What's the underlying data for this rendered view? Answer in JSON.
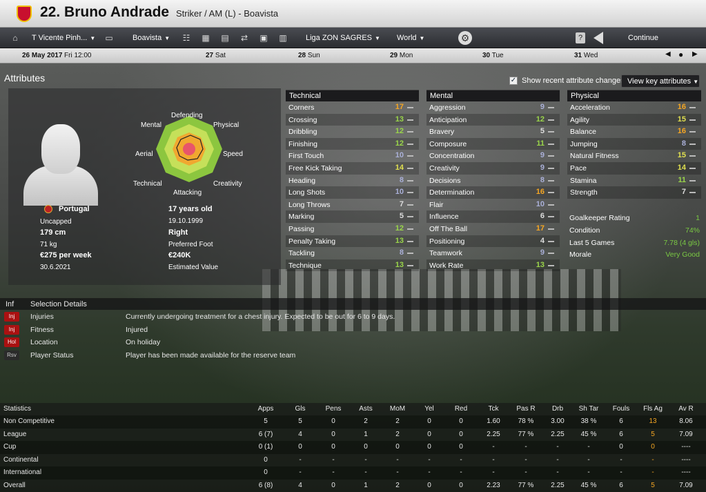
{
  "player": {
    "number_name": "22. Bruno Andrade",
    "position_club": "Striker / AM (L) - Boavista"
  },
  "nav": {
    "manager": "T Vicente Pinh...",
    "club": "Boavista",
    "league": "Liga ZON SAGRES",
    "world": "World",
    "continue": "Continue"
  },
  "datebar": {
    "date": "26 May 2017",
    "day_time": "Fri 12:00",
    "days": [
      {
        "n": "27",
        "d": "Sat"
      },
      {
        "n": "28",
        "d": "Sun"
      },
      {
        "n": "29",
        "d": "Mon"
      },
      {
        "n": "30",
        "d": "Tue"
      },
      {
        "n": "31",
        "d": "Wed"
      }
    ]
  },
  "attributes": {
    "title": "Attributes",
    "show_recent": "Show recent attribute changes",
    "view_key": "View key attributes"
  },
  "radar": {
    "defending": "Defending",
    "physical": "Physical",
    "speed": "Speed",
    "creativity": "Creativity",
    "attacking": "Attacking",
    "technical": "Technical",
    "aerial": "Aerial",
    "mental": "Mental"
  },
  "profile": {
    "nation": "Portugal",
    "caps": "Uncapped",
    "height": "179 cm",
    "weight": "71 kg",
    "wage": "€275 per week",
    "contract": "30.6.2021",
    "age": "17 years old",
    "dob": "19.10.1999",
    "foot": "Right",
    "foot_label": "Preferred Foot",
    "value": "€240K",
    "value_label": "Estimated Value"
  },
  "technical": {
    "title": "Technical",
    "rows": [
      {
        "name": "Corners",
        "value": "17",
        "color": "#f5a623"
      },
      {
        "name": "Crossing",
        "value": "13",
        "color": "#9ad54a"
      },
      {
        "name": "Dribbling",
        "value": "12",
        "color": "#9ad54a"
      },
      {
        "name": "Finishing",
        "value": "12",
        "color": "#9ad54a"
      },
      {
        "name": "First Touch",
        "value": "10",
        "color": "#aab0d8"
      },
      {
        "name": "Free Kick Taking",
        "value": "14",
        "color": "#e0e050"
      },
      {
        "name": "Heading",
        "value": "8",
        "color": "#aab0d8"
      },
      {
        "name": "Long Shots",
        "value": "10",
        "color": "#aab0d8"
      },
      {
        "name": "Long Throws",
        "value": "7",
        "color": "#dddddd"
      },
      {
        "name": "Marking",
        "value": "5",
        "color": "#dddddd"
      },
      {
        "name": "Passing",
        "value": "12",
        "color": "#9ad54a"
      },
      {
        "name": "Penalty Taking",
        "value": "13",
        "color": "#9ad54a"
      },
      {
        "name": "Tackling",
        "value": "8",
        "color": "#aab0d8"
      },
      {
        "name": "Technique",
        "value": "13",
        "color": "#9ad54a"
      }
    ]
  },
  "mental": {
    "title": "Mental",
    "rows": [
      {
        "name": "Aggression",
        "value": "9",
        "color": "#aab0d8"
      },
      {
        "name": "Anticipation",
        "value": "12",
        "color": "#9ad54a"
      },
      {
        "name": "Bravery",
        "value": "5",
        "color": "#dddddd"
      },
      {
        "name": "Composure",
        "value": "11",
        "color": "#9ad54a"
      },
      {
        "name": "Concentration",
        "value": "9",
        "color": "#aab0d8"
      },
      {
        "name": "Creativity",
        "value": "9",
        "color": "#aab0d8"
      },
      {
        "name": "Decisions",
        "value": "8",
        "color": "#aab0d8"
      },
      {
        "name": "Determination",
        "value": "16",
        "color": "#f5a623"
      },
      {
        "name": "Flair",
        "value": "10",
        "color": "#aab0d8"
      },
      {
        "name": "Influence",
        "value": "6",
        "color": "#dddddd"
      },
      {
        "name": "Off The Ball",
        "value": "17",
        "color": "#f5a623"
      },
      {
        "name": "Positioning",
        "value": "4",
        "color": "#dddddd"
      },
      {
        "name": "Teamwork",
        "value": "9",
        "color": "#aab0d8"
      },
      {
        "name": "Work Rate",
        "value": "13",
        "color": "#9ad54a"
      }
    ]
  },
  "physical": {
    "title": "Physical",
    "rows": [
      {
        "name": "Acceleration",
        "value": "16",
        "color": "#f5a623"
      },
      {
        "name": "Agility",
        "value": "15",
        "color": "#e0e050"
      },
      {
        "name": "Balance",
        "value": "16",
        "color": "#f5a623"
      },
      {
        "name": "Jumping",
        "value": "8",
        "color": "#aab0d8"
      },
      {
        "name": "Natural Fitness",
        "value": "15",
        "color": "#e0e050"
      },
      {
        "name": "Pace",
        "value": "14",
        "color": "#e0e050"
      },
      {
        "name": "Stamina",
        "value": "11",
        "color": "#9ad54a"
      },
      {
        "name": "Strength",
        "value": "7",
        "color": "#dddddd"
      }
    ]
  },
  "misc": [
    {
      "name": "Goalkeeper Rating",
      "value": "1"
    },
    {
      "name": "Condition",
      "value": "74%"
    },
    {
      "name": "Last 5 Games",
      "value": "7.78 (4 gls)"
    },
    {
      "name": "Morale",
      "value": "Very Good"
    }
  ],
  "selection": {
    "inf": "Inf",
    "title": "Selection Details",
    "rows": [
      {
        "badge": "Inj",
        "name": "Injuries",
        "desc": "Currently undergoing treatment for a chest injury. Expected to be out for 6 to 9 days."
      },
      {
        "badge": "Inj",
        "name": "Fitness",
        "desc": "Injured"
      },
      {
        "badge": "Hol",
        "name": "Location",
        "desc": "On holiday"
      },
      {
        "badge": "Rsv",
        "name": "Player Status",
        "desc": "Player has been made available for the reserve team"
      }
    ]
  },
  "statistics": {
    "title": "Statistics",
    "headers": [
      "Apps",
      "Gls",
      "Pens",
      "Asts",
      "MoM",
      "Yel",
      "Red",
      "Tck",
      "Pas R",
      "Drb",
      "Sh Tar",
      "Fouls",
      "Fls Ag",
      "Av R"
    ],
    "rows": [
      {
        "label": "Non Competitive",
        "cells": [
          "5",
          "5",
          "0",
          "2",
          "2",
          "0",
          "0",
          "1.60",
          "78 %",
          "3.00",
          "38 %",
          "6",
          "13",
          "8.06"
        ]
      },
      {
        "label": "League",
        "cells": [
          "6 (7)",
          "4",
          "0",
          "1",
          "2",
          "0",
          "0",
          "2.25",
          "77 %",
          "2.25",
          "45 %",
          "6",
          "5",
          "7.09"
        ]
      },
      {
        "label": "Cup",
        "cells": [
          "0 (1)",
          "0",
          "0",
          "0",
          "0",
          "0",
          "0",
          "-",
          "-",
          "-",
          "-",
          "0",
          "0",
          "----"
        ]
      },
      {
        "label": "Continental",
        "cells": [
          "0",
          "-",
          "-",
          "-",
          "-",
          "-",
          "-",
          "-",
          "-",
          "-",
          "-",
          "-",
          "-",
          "----"
        ]
      },
      {
        "label": "International",
        "cells": [
          "0",
          "-",
          "-",
          "-",
          "-",
          "-",
          "-",
          "-",
          "-",
          "-",
          "-",
          "-",
          "-",
          "----"
        ]
      },
      {
        "label": "Overall",
        "cells": [
          "6 (8)",
          "4",
          "0",
          "1",
          "2",
          "0",
          "0",
          "2.23",
          "77 %",
          "2.25",
          "45 %",
          "6",
          "5",
          "7.09"
        ]
      }
    ]
  }
}
